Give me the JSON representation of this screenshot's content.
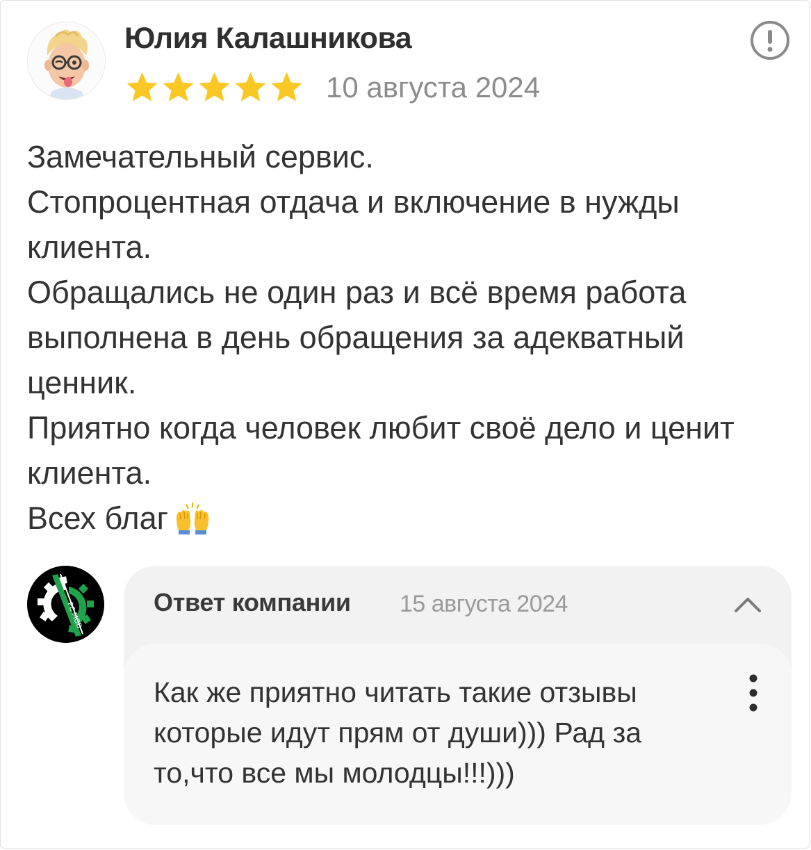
{
  "review": {
    "author_name": "Юлия Калашникова",
    "rating": 5,
    "rating_max": 5,
    "date": "10 августа 2024",
    "text_lines": [
      "Замечательный сервис.",
      "Стопроцентная отдача и включение в нужды клиента.",
      "Обращались не один раз и всё время работа выполнена в день обращения за адекватный ценник.",
      "Приятно когда человек любит своё дело и ценит клиента.",
      "Всех благ"
    ],
    "star_icon": "star-icon",
    "report_icon": "exclamation-circle-icon",
    "emoji_icon": "raising-hands-emoji"
  },
  "company_reply": {
    "title": "Ответ компании",
    "date": "15 августа 2024",
    "text": "Как же приятно читать такие отзывы которые идут прям от души))) Рад за то,что все мы молодцы!!!)))",
    "collapse_icon": "chevron-up-icon",
    "more_icon": "more-vertical-icon",
    "logo_text": "PC MOB"
  },
  "colors": {
    "star": "#f9c825",
    "reply_bg": "#f2f2f2",
    "logo_green": "#1fa34a",
    "muted_text": "#8c8c8c"
  }
}
